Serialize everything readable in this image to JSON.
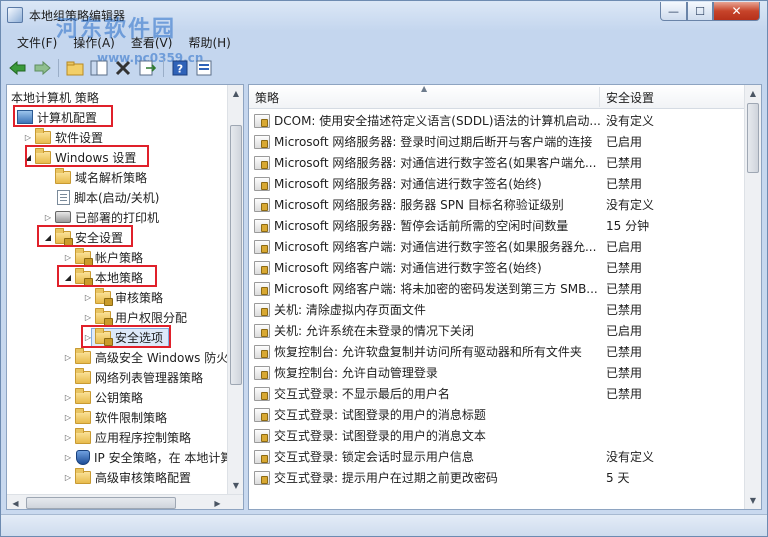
{
  "window": {
    "title": "本地组策略编辑器",
    "watermark": "河东软件园",
    "watermark_url": "www.pc0359.cn",
    "controls": {
      "minimize": "—",
      "maximize": "☐",
      "close": "✕"
    }
  },
  "menu": {
    "items": [
      "文件(F)",
      "操作(A)",
      "查看(V)",
      "帮助(H)"
    ]
  },
  "toolbar": {
    "buttons": [
      "back-icon",
      "forward-icon",
      "up-folder-icon",
      "show-hide-tree-icon",
      "delete-icon",
      "export-list-icon",
      "help-icon",
      "properties-icon"
    ]
  },
  "tree": {
    "items": [
      {
        "label": "本地计算机 策略"
      },
      {
        "label": "计算机配置"
      },
      {
        "label": "软件设置"
      },
      {
        "label": "Windows 设置"
      },
      {
        "label": "域名解析策略"
      },
      {
        "label": "脚本(启动/关机)"
      },
      {
        "label": "已部署的打印机"
      },
      {
        "label": "安全设置"
      },
      {
        "label": "帐户策略"
      },
      {
        "label": "本地策略"
      },
      {
        "label": "审核策略"
      },
      {
        "label": "用户权限分配"
      },
      {
        "label": "安全选项"
      },
      {
        "label": "高级安全 Windows 防火"
      },
      {
        "label": "网络列表管理器策略"
      },
      {
        "label": "公钥策略"
      },
      {
        "label": "软件限制策略"
      },
      {
        "label": "应用程序控制策略"
      },
      {
        "label": "IP 安全策略，在 本地计算"
      },
      {
        "label": "高级审核策略配置"
      }
    ]
  },
  "list": {
    "columns": {
      "policy": "策略",
      "setting": "安全设置"
    },
    "rows": [
      {
        "policy": "DCOM: 使用安全描述符定义语言(SDDL)语法的计算机启动...",
        "setting": "没有定义"
      },
      {
        "policy": "Microsoft 网络服务器: 登录时间过期后断开与客户端的连接",
        "setting": "已启用"
      },
      {
        "policy": "Microsoft 网络服务器: 对通信进行数字签名(如果客户端允...",
        "setting": "已禁用"
      },
      {
        "policy": "Microsoft 网络服务器: 对通信进行数字签名(始终)",
        "setting": "已禁用"
      },
      {
        "policy": "Microsoft 网络服务器: 服务器 SPN 目标名称验证级别",
        "setting": "没有定义"
      },
      {
        "policy": "Microsoft 网络服务器: 暂停会话前所需的空闲时间数量",
        "setting": "15 分钟"
      },
      {
        "policy": "Microsoft 网络客户端: 对通信进行数字签名(如果服务器允...",
        "setting": "已启用"
      },
      {
        "policy": "Microsoft 网络客户端: 对通信进行数字签名(始终)",
        "setting": "已禁用"
      },
      {
        "policy": "Microsoft 网络客户端: 将未加密的密码发送到第三方 SMB...",
        "setting": "已禁用"
      },
      {
        "policy": "关机: 清除虚拟内存页面文件",
        "setting": "已禁用"
      },
      {
        "policy": "关机: 允许系统在未登录的情况下关闭",
        "setting": "已启用"
      },
      {
        "policy": "恢复控制台: 允许软盘复制并访问所有驱动器和所有文件夹",
        "setting": "已禁用"
      },
      {
        "policy": "恢复控制台: 允许自动管理登录",
        "setting": "已禁用"
      },
      {
        "policy": "交互式登录: 不显示最后的用户名",
        "setting": "已禁用"
      },
      {
        "policy": "交互式登录: 试图登录的用户的消息标题",
        "setting": ""
      },
      {
        "policy": "交互式登录: 试图登录的用户的消息文本",
        "setting": ""
      },
      {
        "policy": "交互式登录: 锁定会话时显示用户信息",
        "setting": "没有定义"
      },
      {
        "policy": "交互式登录: 提示用户在过期之前更改密码",
        "setting": "5 天"
      }
    ]
  },
  "colors": {
    "highlight_border": "#e0202a",
    "selection_bg": "#dde9f9"
  }
}
